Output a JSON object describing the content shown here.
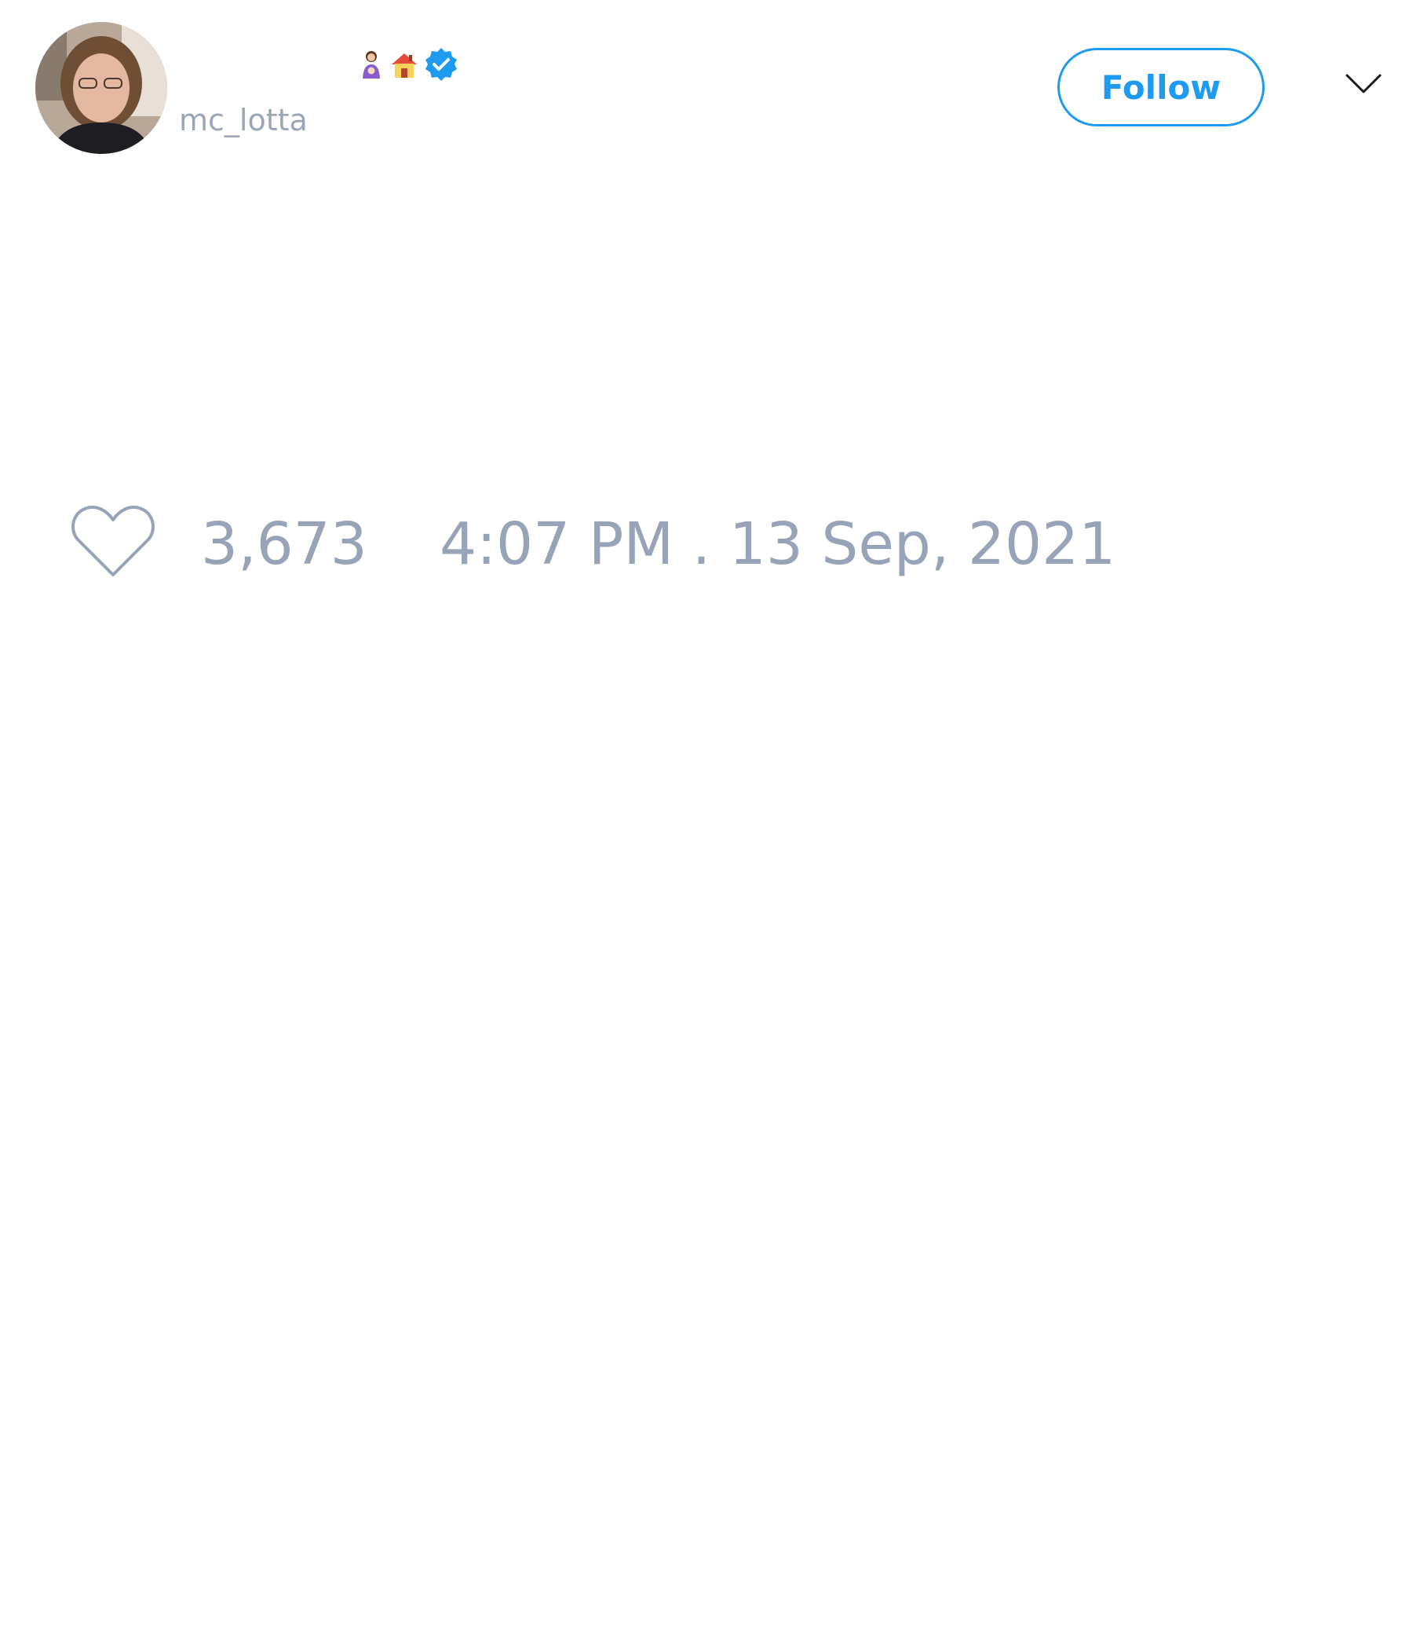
{
  "tweet": {
    "author": {
      "handle": "mc_lotta",
      "verified": true,
      "name_emoji": [
        "woman-with-baby-emoji",
        "house-emoji"
      ]
    },
    "follow_label": "Follow",
    "like_count": "3,673",
    "timestamp": "4:07 PM . 13 Sep, 2021"
  },
  "colors": {
    "accent": "#1d9bf0",
    "muted_text": "#97a3b8",
    "background": "#ffffff"
  },
  "icons": {
    "avatar": "avatar-photo",
    "verified": "verified-badge-icon",
    "more": "chevron-down-icon",
    "like": "heart-outline-icon"
  }
}
